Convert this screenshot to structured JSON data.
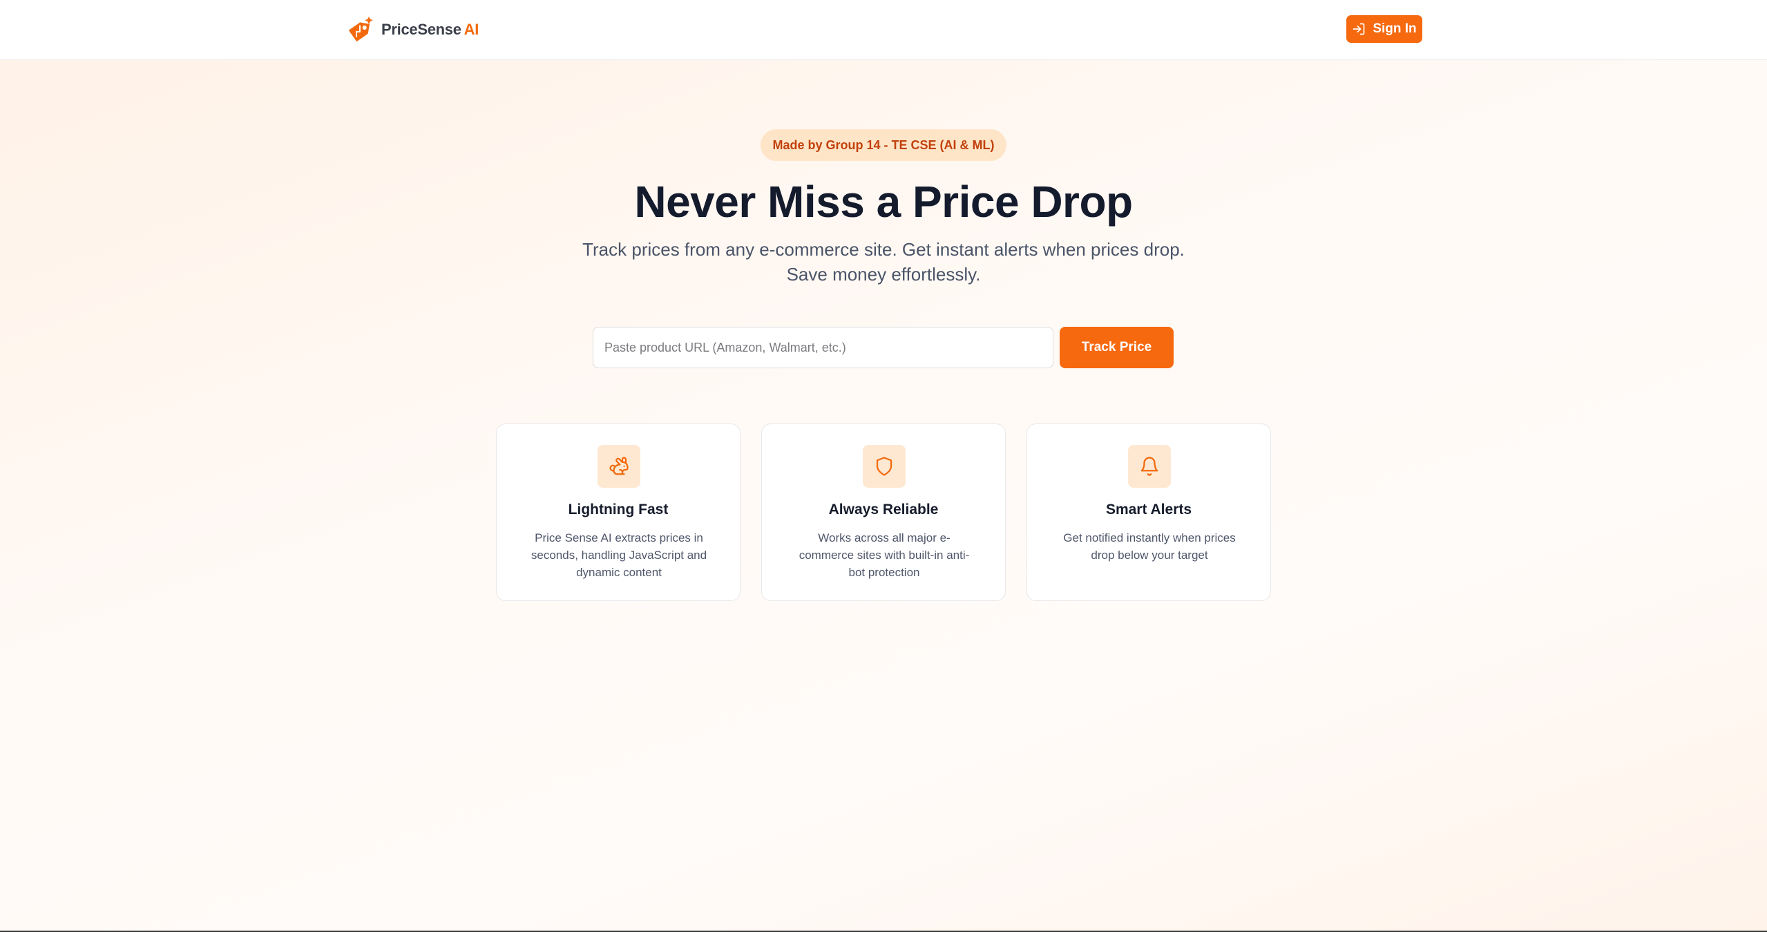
{
  "header": {
    "logo_name": "PriceSense",
    "logo_accent": "AI",
    "signin_label": "Sign In"
  },
  "hero": {
    "badge": "Made by Group 14 - TE CSE (AI & ML)",
    "title": "Never Miss a Price Drop",
    "subtitle_line1": "Track prices from any e-commerce site. Get instant alerts when prices drop.",
    "subtitle_line2": "Save money effortlessly."
  },
  "search": {
    "placeholder": "Paste product URL (Amazon, Walmart, etc.)",
    "value": "",
    "button_label": "Track Price"
  },
  "features": [
    {
      "icon": "rabbit-icon",
      "title": "Lightning Fast",
      "description": "Price Sense AI extracts prices in seconds, handling JavaScript and dynamic content"
    },
    {
      "icon": "shield-icon",
      "title": "Always Reliable",
      "description": "Works across all major e-commerce sites with built-in anti-bot protection"
    },
    {
      "icon": "bell-icon",
      "title": "Smart Alerts",
      "description": "Get notified instantly when prices drop below your target"
    }
  ],
  "colors": {
    "accent": "#f6690f",
    "badge_bg": "#ffe5c8",
    "badge_text": "#c2410c",
    "icon_bg": "#ffe8d2",
    "heading": "#141b2d"
  }
}
